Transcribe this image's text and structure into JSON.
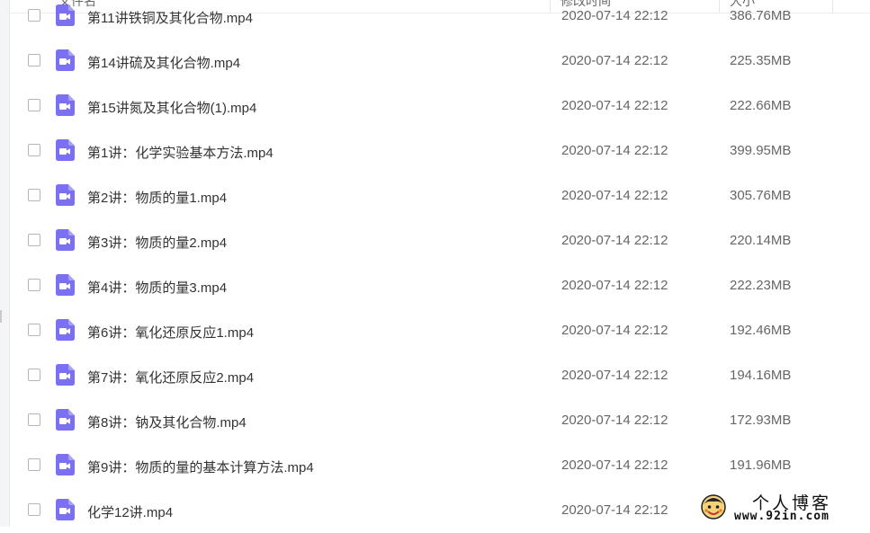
{
  "header": {
    "name_label": "文件名",
    "modified_label": "修改时间",
    "size_label": "大小"
  },
  "files": [
    {
      "name": "第11讲铁铜及其化合物.mp4",
      "modified": "2020-07-14 22:12",
      "size": "386.76MB"
    },
    {
      "name": "第14讲硫及其化合物.mp4",
      "modified": "2020-07-14 22:12",
      "size": "225.35MB"
    },
    {
      "name": "第15讲氮及其化合物(1).mp4",
      "modified": "2020-07-14 22:12",
      "size": "222.66MB"
    },
    {
      "name": "第1讲：化学实验基本方法.mp4",
      "modified": "2020-07-14 22:12",
      "size": "399.95MB"
    },
    {
      "name": "第2讲：物质的量1.mp4",
      "modified": "2020-07-14 22:12",
      "size": "305.76MB"
    },
    {
      "name": "第3讲：物质的量2.mp4",
      "modified": "2020-07-14 22:12",
      "size": "220.14MB"
    },
    {
      "name": "第4讲：物质的量3.mp4",
      "modified": "2020-07-14 22:12",
      "size": "222.23MB"
    },
    {
      "name": "第6讲：氧化还原反应1.mp4",
      "modified": "2020-07-14 22:12",
      "size": "192.46MB"
    },
    {
      "name": "第7讲：氧化还原反应2.mp4",
      "modified": "2020-07-14 22:12",
      "size": "194.16MB"
    },
    {
      "name": "第8讲：钠及其化合物.mp4",
      "modified": "2020-07-14 22:12",
      "size": "172.93MB"
    },
    {
      "name": "第9讲：物质的量的基本计算方法.mp4",
      "modified": "2020-07-14 22:12",
      "size": "191.96MB"
    },
    {
      "name": "化学12讲.mp4",
      "modified": "2020-07-14 22:12",
      "size": ""
    }
  ],
  "watermark": {
    "title": "个人博客",
    "url": "www.92in.com"
  },
  "colors": {
    "video_icon": "#7b6ff2",
    "text": "#333333",
    "muted": "#666666"
  },
  "icons": {
    "file": "video-file-icon",
    "checkbox": "checkbox-icon"
  }
}
